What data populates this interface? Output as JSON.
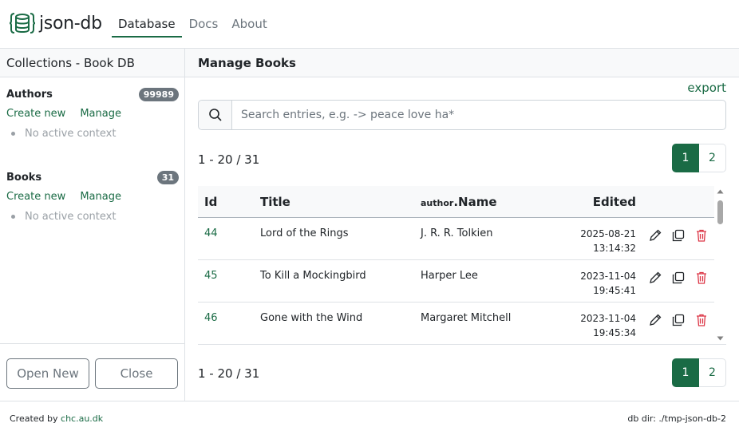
{
  "app": {
    "name": "json-db",
    "logo_icon": "database-braces-icon",
    "accent_color": "#1a6b45"
  },
  "nav": {
    "items": [
      {
        "label": "Database",
        "active": true
      },
      {
        "label": "Docs",
        "active": false
      },
      {
        "label": "About",
        "active": false
      }
    ]
  },
  "sidebar": {
    "title": "Collections - Book DB",
    "collections": [
      {
        "name": "Authors",
        "count": "99989",
        "create_label": "Create new",
        "manage_label": "Manage",
        "context": "No active context"
      },
      {
        "name": "Books",
        "count": "31",
        "create_label": "Create new",
        "manage_label": "Manage",
        "context": "No active context"
      }
    ],
    "open_new_label": "Open New",
    "close_label": "Close"
  },
  "main": {
    "title": "Manage Books",
    "export_label": "export",
    "search": {
      "placeholder": "Search entries, e.g. -> peace love ha*",
      "value": ""
    },
    "range_label": "1 - 20 / 31",
    "pages": [
      "1",
      "2"
    ],
    "current_page": "1",
    "table": {
      "headers": {
        "id": "Id",
        "title": "Title",
        "author_prefix": "author",
        "author_field": "Name",
        "edited": "Edited"
      },
      "rows": [
        {
          "id": "44",
          "title": "Lord of the Rings",
          "author": "J. R. R. Tolkien",
          "edited_date": "2025-08-21",
          "edited_time": "13:14:32"
        },
        {
          "id": "45",
          "title": "To Kill a Mockingbird",
          "author": "Harper Lee",
          "edited_date": "2023-11-04",
          "edited_time": "19:45:41"
        },
        {
          "id": "46",
          "title": "Gone with the Wind",
          "author": "Margaret Mitchell",
          "edited_date": "2023-11-04",
          "edited_time": "19:45:34"
        }
      ]
    }
  },
  "footer": {
    "created_by_prefix": "Created by",
    "created_by_link": "chc.au.dk",
    "db_dir": "db dir: ./tmp-json-db-2"
  }
}
